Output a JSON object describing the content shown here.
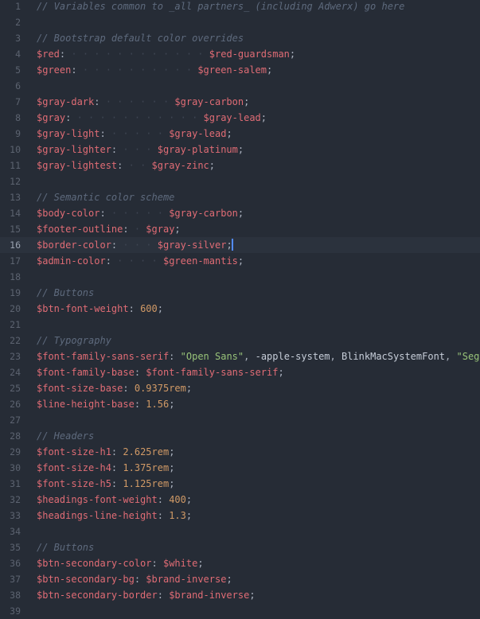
{
  "editor": {
    "colors": {
      "background": "#262c36",
      "current_line": "#2b323d",
      "comment": "#5e6a7d",
      "variable": "#e06c75",
      "number": "#d19a66",
      "string": "#98c379",
      "cursor": "#528bff"
    },
    "cursor_line": 16,
    "lines": [
      {
        "n": "1",
        "tokens": [
          {
            "c": "comment",
            "t": "// Variables common to _all partners_ (including Adwerx) go here"
          }
        ]
      },
      {
        "n": "2",
        "tokens": []
      },
      {
        "n": "3",
        "tokens": [
          {
            "c": "comment",
            "t": "// Bootstrap default color overrides"
          }
        ]
      },
      {
        "n": "4",
        "tokens": [
          {
            "c": "var",
            "t": "$red"
          },
          {
            "c": "punct",
            "t": ":"
          },
          {
            "c": "ws",
            "t": " · · · · · · · · · · · · "
          },
          {
            "c": "var",
            "t": "$red-guardsman"
          },
          {
            "c": "punct",
            "t": ";"
          }
        ]
      },
      {
        "n": "5",
        "tokens": [
          {
            "c": "var",
            "t": "$green"
          },
          {
            "c": "punct",
            "t": ":"
          },
          {
            "c": "ws",
            "t": " · · · · · · · · · · "
          },
          {
            "c": "var",
            "t": "$green-salem"
          },
          {
            "c": "punct",
            "t": ";"
          }
        ]
      },
      {
        "n": "6",
        "tokens": []
      },
      {
        "n": "7",
        "tokens": [
          {
            "c": "var",
            "t": "$gray-dark"
          },
          {
            "c": "punct",
            "t": ":"
          },
          {
            "c": "ws",
            "t": " · · · · · · "
          },
          {
            "c": "var",
            "t": "$gray-carbon"
          },
          {
            "c": "punct",
            "t": ";"
          }
        ]
      },
      {
        "n": "8",
        "tokens": [
          {
            "c": "var",
            "t": "$gray"
          },
          {
            "c": "punct",
            "t": ":"
          },
          {
            "c": "ws",
            "t": " · · · · · · · · · · · "
          },
          {
            "c": "var",
            "t": "$gray-lead"
          },
          {
            "c": "punct",
            "t": ";"
          }
        ]
      },
      {
        "n": "9",
        "tokens": [
          {
            "c": "var",
            "t": "$gray-light"
          },
          {
            "c": "punct",
            "t": ":"
          },
          {
            "c": "ws",
            "t": " · · · · · "
          },
          {
            "c": "var",
            "t": "$gray-lead"
          },
          {
            "c": "punct",
            "t": ";"
          }
        ]
      },
      {
        "n": "10",
        "tokens": [
          {
            "c": "var",
            "t": "$gray-lighter"
          },
          {
            "c": "punct",
            "t": ":"
          },
          {
            "c": "ws",
            "t": " · · · "
          },
          {
            "c": "var",
            "t": "$gray-platinum"
          },
          {
            "c": "punct",
            "t": ";"
          }
        ]
      },
      {
        "n": "11",
        "tokens": [
          {
            "c": "var",
            "t": "$gray-lightest"
          },
          {
            "c": "punct",
            "t": ":"
          },
          {
            "c": "ws",
            "t": " · · "
          },
          {
            "c": "var",
            "t": "$gray-zinc"
          },
          {
            "c": "punct",
            "t": ";"
          }
        ]
      },
      {
        "n": "12",
        "tokens": []
      },
      {
        "n": "13",
        "tokens": [
          {
            "c": "comment",
            "t": "// Semantic color scheme"
          }
        ]
      },
      {
        "n": "14",
        "tokens": [
          {
            "c": "var",
            "t": "$body-color"
          },
          {
            "c": "punct",
            "t": ":"
          },
          {
            "c": "ws",
            "t": " · · · · · "
          },
          {
            "c": "var",
            "t": "$gray-carbon"
          },
          {
            "c": "punct",
            "t": ";"
          }
        ]
      },
      {
        "n": "15",
        "tokens": [
          {
            "c": "var",
            "t": "$footer-outline"
          },
          {
            "c": "punct",
            "t": ":"
          },
          {
            "c": "ws",
            "t": " · "
          },
          {
            "c": "var",
            "t": "$gray"
          },
          {
            "c": "punct",
            "t": ";"
          }
        ]
      },
      {
        "n": "16",
        "tokens": [
          {
            "c": "var",
            "t": "$border-color"
          },
          {
            "c": "punct",
            "t": ":"
          },
          {
            "c": "ws",
            "t": " · · · "
          },
          {
            "c": "var",
            "t": "$gray-silver"
          },
          {
            "c": "punct",
            "t": ";"
          },
          {
            "c": "cursor",
            "t": ""
          }
        ]
      },
      {
        "n": "17",
        "tokens": [
          {
            "c": "var",
            "t": "$admin-color"
          },
          {
            "c": "punct",
            "t": ":"
          },
          {
            "c": "ws",
            "t": " · · · · "
          },
          {
            "c": "var",
            "t": "$green-mantis"
          },
          {
            "c": "punct",
            "t": ";"
          }
        ]
      },
      {
        "n": "18",
        "tokens": []
      },
      {
        "n": "19",
        "tokens": [
          {
            "c": "comment",
            "t": "// Buttons"
          }
        ]
      },
      {
        "n": "20",
        "tokens": [
          {
            "c": "var",
            "t": "$btn-font-weight"
          },
          {
            "c": "punct",
            "t": ":"
          },
          {
            "c": "ws",
            "t": " "
          },
          {
            "c": "num",
            "t": "600"
          },
          {
            "c": "punct",
            "t": ";"
          }
        ]
      },
      {
        "n": "21",
        "tokens": []
      },
      {
        "n": "22",
        "tokens": [
          {
            "c": "comment",
            "t": "// Typography"
          }
        ]
      },
      {
        "n": "23",
        "tokens": [
          {
            "c": "var",
            "t": "$font-family-sans-serif"
          },
          {
            "c": "punct",
            "t": ":"
          },
          {
            "c": "ws",
            "t": " "
          },
          {
            "c": "str",
            "t": "\"Open Sans\""
          },
          {
            "c": "punct",
            "t": ","
          },
          {
            "c": "ws",
            "t": " "
          },
          {
            "c": "plain",
            "t": "-apple-system"
          },
          {
            "c": "punct",
            "t": ","
          },
          {
            "c": "ws",
            "t": " "
          },
          {
            "c": "plain",
            "t": "BlinkMacSystemFont"
          },
          {
            "c": "punct",
            "t": ","
          },
          {
            "c": "ws",
            "t": " "
          },
          {
            "c": "str",
            "t": "\"Segoe"
          }
        ]
      },
      {
        "n": "24",
        "tokens": [
          {
            "c": "var",
            "t": "$font-family-base"
          },
          {
            "c": "punct",
            "t": ":"
          },
          {
            "c": "ws",
            "t": " "
          },
          {
            "c": "var",
            "t": "$font-family-sans-serif"
          },
          {
            "c": "punct",
            "t": ";"
          }
        ]
      },
      {
        "n": "25",
        "tokens": [
          {
            "c": "var",
            "t": "$font-size-base"
          },
          {
            "c": "punct",
            "t": ":"
          },
          {
            "c": "ws",
            "t": " "
          },
          {
            "c": "num",
            "t": "0.9375rem"
          },
          {
            "c": "punct",
            "t": ";"
          }
        ]
      },
      {
        "n": "26",
        "tokens": [
          {
            "c": "var",
            "t": "$line-height-base"
          },
          {
            "c": "punct",
            "t": ":"
          },
          {
            "c": "ws",
            "t": " "
          },
          {
            "c": "num",
            "t": "1.56"
          },
          {
            "c": "punct",
            "t": ";"
          }
        ]
      },
      {
        "n": "27",
        "tokens": []
      },
      {
        "n": "28",
        "tokens": [
          {
            "c": "comment",
            "t": "// Headers"
          }
        ]
      },
      {
        "n": "29",
        "tokens": [
          {
            "c": "var",
            "t": "$font-size-h1"
          },
          {
            "c": "punct",
            "t": ":"
          },
          {
            "c": "ws",
            "t": " "
          },
          {
            "c": "num",
            "t": "2.625rem"
          },
          {
            "c": "punct",
            "t": ";"
          }
        ]
      },
      {
        "n": "30",
        "tokens": [
          {
            "c": "var",
            "t": "$font-size-h4"
          },
          {
            "c": "punct",
            "t": ":"
          },
          {
            "c": "ws",
            "t": " "
          },
          {
            "c": "num",
            "t": "1.375rem"
          },
          {
            "c": "punct",
            "t": ";"
          }
        ]
      },
      {
        "n": "31",
        "tokens": [
          {
            "c": "var",
            "t": "$font-size-h5"
          },
          {
            "c": "punct",
            "t": ":"
          },
          {
            "c": "ws",
            "t": " "
          },
          {
            "c": "num",
            "t": "1.125rem"
          },
          {
            "c": "punct",
            "t": ";"
          }
        ]
      },
      {
        "n": "32",
        "tokens": [
          {
            "c": "var",
            "t": "$headings-font-weight"
          },
          {
            "c": "punct",
            "t": ":"
          },
          {
            "c": "ws",
            "t": " "
          },
          {
            "c": "num",
            "t": "400"
          },
          {
            "c": "punct",
            "t": ";"
          }
        ]
      },
      {
        "n": "33",
        "tokens": [
          {
            "c": "var",
            "t": "$headings-line-height"
          },
          {
            "c": "punct",
            "t": ":"
          },
          {
            "c": "ws",
            "t": " "
          },
          {
            "c": "num",
            "t": "1.3"
          },
          {
            "c": "punct",
            "t": ";"
          }
        ]
      },
      {
        "n": "34",
        "tokens": []
      },
      {
        "n": "35",
        "tokens": [
          {
            "c": "comment",
            "t": "// Buttons"
          }
        ]
      },
      {
        "n": "36",
        "tokens": [
          {
            "c": "var",
            "t": "$btn-secondary-color"
          },
          {
            "c": "punct",
            "t": ":"
          },
          {
            "c": "ws",
            "t": " "
          },
          {
            "c": "var",
            "t": "$white"
          },
          {
            "c": "punct",
            "t": ";"
          }
        ]
      },
      {
        "n": "37",
        "tokens": [
          {
            "c": "var",
            "t": "$btn-secondary-bg"
          },
          {
            "c": "punct",
            "t": ":"
          },
          {
            "c": "ws",
            "t": " "
          },
          {
            "c": "var",
            "t": "$brand-inverse"
          },
          {
            "c": "punct",
            "t": ";"
          }
        ]
      },
      {
        "n": "38",
        "tokens": [
          {
            "c": "var",
            "t": "$btn-secondary-border"
          },
          {
            "c": "punct",
            "t": ":"
          },
          {
            "c": "ws",
            "t": " "
          },
          {
            "c": "var",
            "t": "$brand-inverse"
          },
          {
            "c": "punct",
            "t": ";"
          }
        ]
      },
      {
        "n": "39",
        "tokens": []
      }
    ]
  }
}
